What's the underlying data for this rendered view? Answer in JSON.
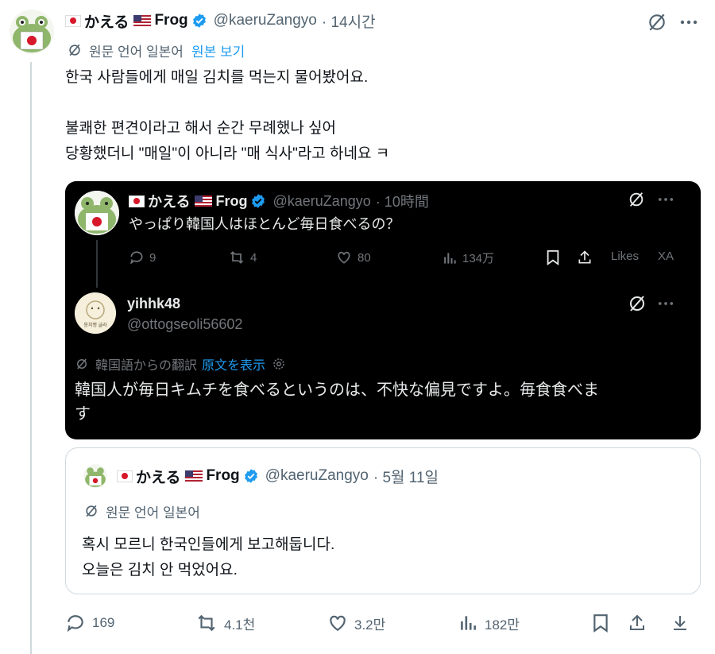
{
  "main": {
    "author": {
      "name_jp": "かえる",
      "name_en": "Frog",
      "handle": "@kaeruZangyo",
      "time": "· 14시간"
    },
    "translation": {
      "label": "원문 언어 일본어",
      "link": "원본 보기"
    },
    "lines": [
      "한국 사람들에게 매일 김치를 먹는지 물어봤어요.",
      "불쾌한 편견이라고 해서 순간 무례했나 싶어",
      "당황했더니 \"매일\"이 아니라 \"매 식사\"라고 하네요 ㅋ"
    ],
    "actions": {
      "replies": "169",
      "retweets": "4.1천",
      "likes": "3.2만",
      "views": "182만"
    }
  },
  "screenshot": {
    "post1": {
      "name_jp": "かえる",
      "name_en": "Frog",
      "handle": "@kaeruZangyo",
      "time": "· 10時間",
      "text": "やっぱり韓国人はほとんど毎日食べるの？",
      "actions": {
        "replies": "9",
        "retweets": "4",
        "likes": "80",
        "views": "134万",
        "likes_label": "Likes",
        "xa": "XA"
      }
    },
    "post2": {
      "name": "yihhk48",
      "handle": "@ottogseoli56602",
      "avatar_text": "옹치맹 글라",
      "translation_label": "韓国語からの翻訳",
      "translation_link": "原文を表示",
      "text_line1": "韓国人が毎日キムチを食べるというのは、不快な偏見ですよ。毎食食べま",
      "text_line2": "す"
    }
  },
  "quote": {
    "name_jp": "かえる",
    "name_en": "Frog",
    "handle": "@kaeruZangyo",
    "time": "· 5월 11일",
    "translation_label": "원문 언어 일본어",
    "lines": [
      "혹시 모르니 한국인들에게 보고해둡니다.",
      "오늘은 김치 안 먹었어요."
    ]
  },
  "colors": {
    "accent": "#1d9bf0",
    "text": "#0f1419",
    "muted": "#536471",
    "dark_bg": "#000000"
  }
}
